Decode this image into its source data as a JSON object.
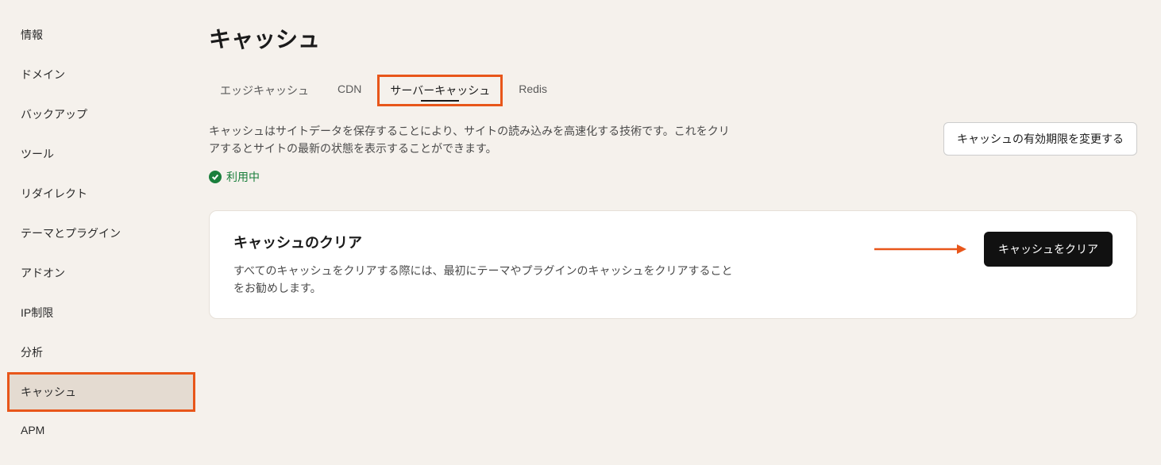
{
  "sidebar": {
    "items": [
      {
        "label": "情報",
        "active": false
      },
      {
        "label": "ドメイン",
        "active": false
      },
      {
        "label": "バックアップ",
        "active": false
      },
      {
        "label": "ツール",
        "active": false
      },
      {
        "label": "リダイレクト",
        "active": false
      },
      {
        "label": "テーマとプラグイン",
        "active": false
      },
      {
        "label": "アドオン",
        "active": false
      },
      {
        "label": "IP制限",
        "active": false
      },
      {
        "label": "分析",
        "active": false
      },
      {
        "label": "キャッシュ",
        "active": true
      },
      {
        "label": "APM",
        "active": false
      }
    ]
  },
  "page": {
    "title": "キャッシュ"
  },
  "tabs": [
    {
      "label": "エッジキャッシュ",
      "active": false
    },
    {
      "label": "CDN",
      "active": false
    },
    {
      "label": "サーバーキャッシュ",
      "active": true
    },
    {
      "label": "Redis",
      "active": false
    }
  ],
  "description": "キャッシュはサイトデータを保存することにより、サイトの読み込みを高速化する技術です。これをクリアするとサイトの最新の状態を表示することができます。",
  "change_expiry_button": "キャッシュの有効期限を変更する",
  "status": {
    "text": "利用中"
  },
  "card": {
    "title": "キャッシュのクリア",
    "description": "すべてのキャッシュをクリアする際には、最初にテーマやプラグインのキャッシュをクリアすることをお勧めします。",
    "button": "キャッシュをクリア"
  },
  "colors": {
    "accent": "#e8561a",
    "success": "#1a7f3c",
    "bg": "#f5f1ec",
    "button_primary": "#111111"
  }
}
